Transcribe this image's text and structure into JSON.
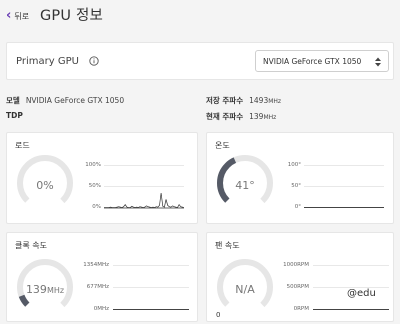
{
  "header": {
    "back_label": "뒤로",
    "title": "GPU 정보"
  },
  "primary": {
    "label": "Primary GPU",
    "selected": "NVIDIA GeForce GTX 1050"
  },
  "info": {
    "model_key": "모델",
    "model_value": "NVIDIA GeForce GTX 1050",
    "tdp_key": "TDP",
    "stored_freq_key": "저장 주파수",
    "stored_freq_value": "1493",
    "stored_freq_unit": "MHz",
    "current_freq_key": "현재 주파수",
    "current_freq_value": "139",
    "current_freq_unit": "MHz"
  },
  "load": {
    "title": "로드",
    "value": "0%",
    "level": 0,
    "ticks": [
      "100%",
      "50%",
      "0%"
    ],
    "history": [
      1,
      1,
      1,
      1,
      2,
      1,
      1,
      1,
      2,
      3,
      2,
      1,
      3,
      8,
      2,
      1,
      1,
      4,
      2,
      1,
      2,
      1,
      3,
      2,
      1,
      2,
      5,
      3,
      2,
      1,
      2,
      1,
      3,
      2,
      6,
      35,
      4,
      2,
      20,
      6,
      3,
      2,
      5,
      3,
      2,
      1,
      8,
      3,
      2,
      1
    ]
  },
  "temp": {
    "title": "온도",
    "value": "41°",
    "level": 0.41,
    "ticks": [
      "100°",
      "50°",
      "0°"
    ]
  },
  "clock": {
    "title": "클록 속도",
    "value": "139",
    "unit": "MHz",
    "level": 0.09,
    "ticks": [
      "1354MHz",
      "677MHz",
      "0MHz"
    ]
  },
  "fan": {
    "title": "팬 속도",
    "value": "N/A",
    "min_label": "0",
    "ticks": [
      "1000RPM",
      "500RPM",
      "0RPM"
    ]
  },
  "watermark": "@edu",
  "colors": {
    "accent": "#6b3fb5",
    "gauge_fill": "#555a66",
    "gauge_track": "#e6e6e6"
  }
}
